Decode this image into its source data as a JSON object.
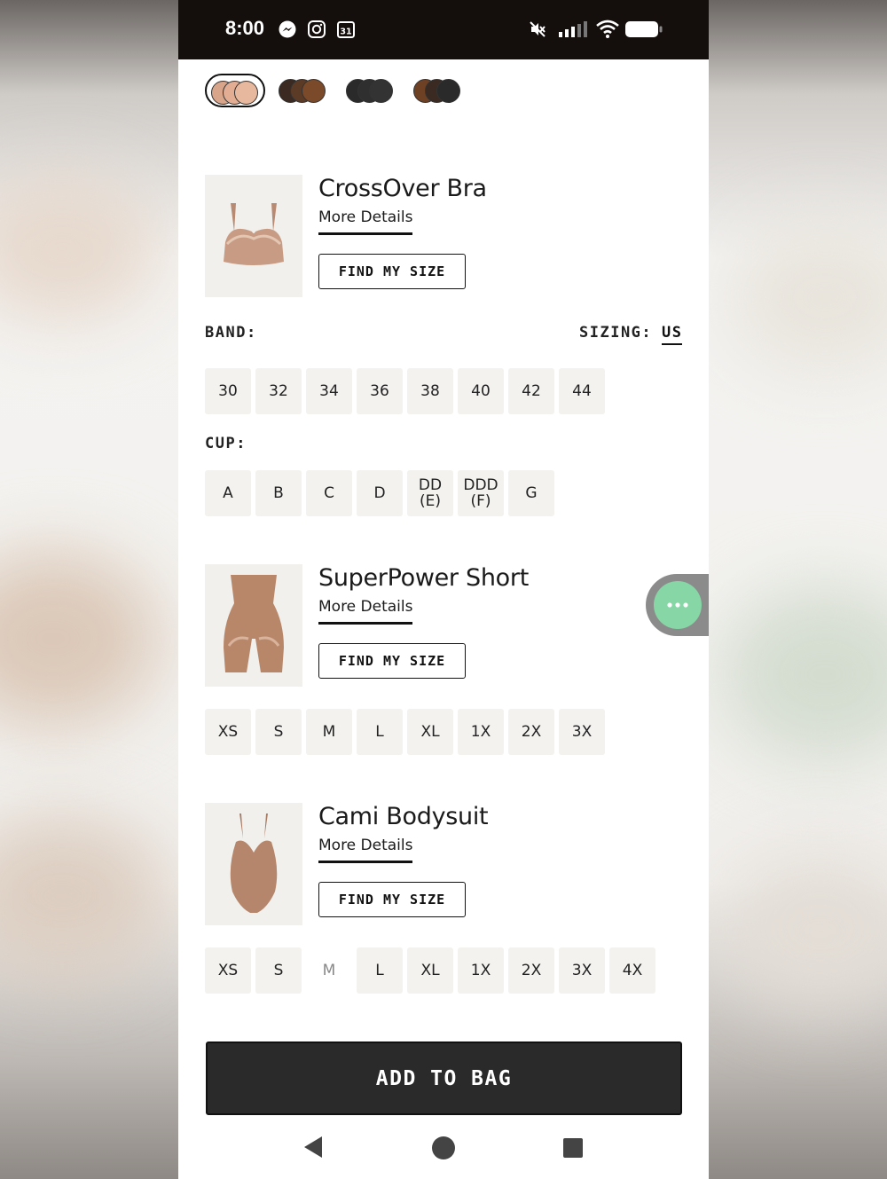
{
  "status_bar": {
    "time": "8:00",
    "left_icons": [
      "messenger-icon",
      "instagram-icon",
      "calendar-icon"
    ],
    "calendar_day": "31",
    "right_icons": [
      "mute-icon",
      "signal-icon",
      "wifi-icon",
      "battery-icon"
    ]
  },
  "color_swatches": [
    {
      "name": "light-nude",
      "colors": [
        "#d9a58a",
        "#e2ad92",
        "#e8b89e"
      ],
      "selected": true
    },
    {
      "name": "brown-mix",
      "colors": [
        "#3a2a22",
        "#5b3a26",
        "#7a4a2a"
      ],
      "selected": false
    },
    {
      "name": "black",
      "colors": [
        "#2a2a2a",
        "#2f2f2f",
        "#333333"
      ],
      "selected": false
    },
    {
      "name": "brown-black",
      "colors": [
        "#6e4024",
        "#3a2a22",
        "#2a2a2a"
      ],
      "selected": false
    }
  ],
  "products": [
    {
      "name": "CrossOver Bra",
      "more_details": "More Details",
      "find_size": "FIND MY SIZE"
    },
    {
      "name": "SuperPower Short",
      "more_details": "More Details",
      "find_size": "FIND MY SIZE"
    },
    {
      "name": "Cami Bodysuit",
      "more_details": "More Details",
      "find_size": "FIND MY SIZE"
    }
  ],
  "bra_options": {
    "band_label": "BAND:",
    "sizing_label": "SIZING:",
    "sizing_value": "US",
    "bands": [
      "30",
      "32",
      "34",
      "36",
      "38",
      "40",
      "42",
      "44"
    ],
    "cup_label": "CUP:",
    "cups": [
      "A",
      "B",
      "C",
      "D",
      "DD\n(E)",
      "DDD\n(F)",
      "G"
    ]
  },
  "short_sizes": [
    "XS",
    "S",
    "M",
    "L",
    "XL",
    "1X",
    "2X",
    "3X"
  ],
  "bodysuit_sizes": [
    "XS",
    "S",
    "M",
    "L",
    "XL",
    "1X",
    "2X",
    "3X",
    "4X"
  ],
  "bodysuit_disabled": [
    "M"
  ],
  "add_to_bag": "ADD TO BAG",
  "chat_button_icon": "more-dots-icon",
  "nav": [
    "back-icon",
    "home-icon",
    "recents-icon"
  ]
}
